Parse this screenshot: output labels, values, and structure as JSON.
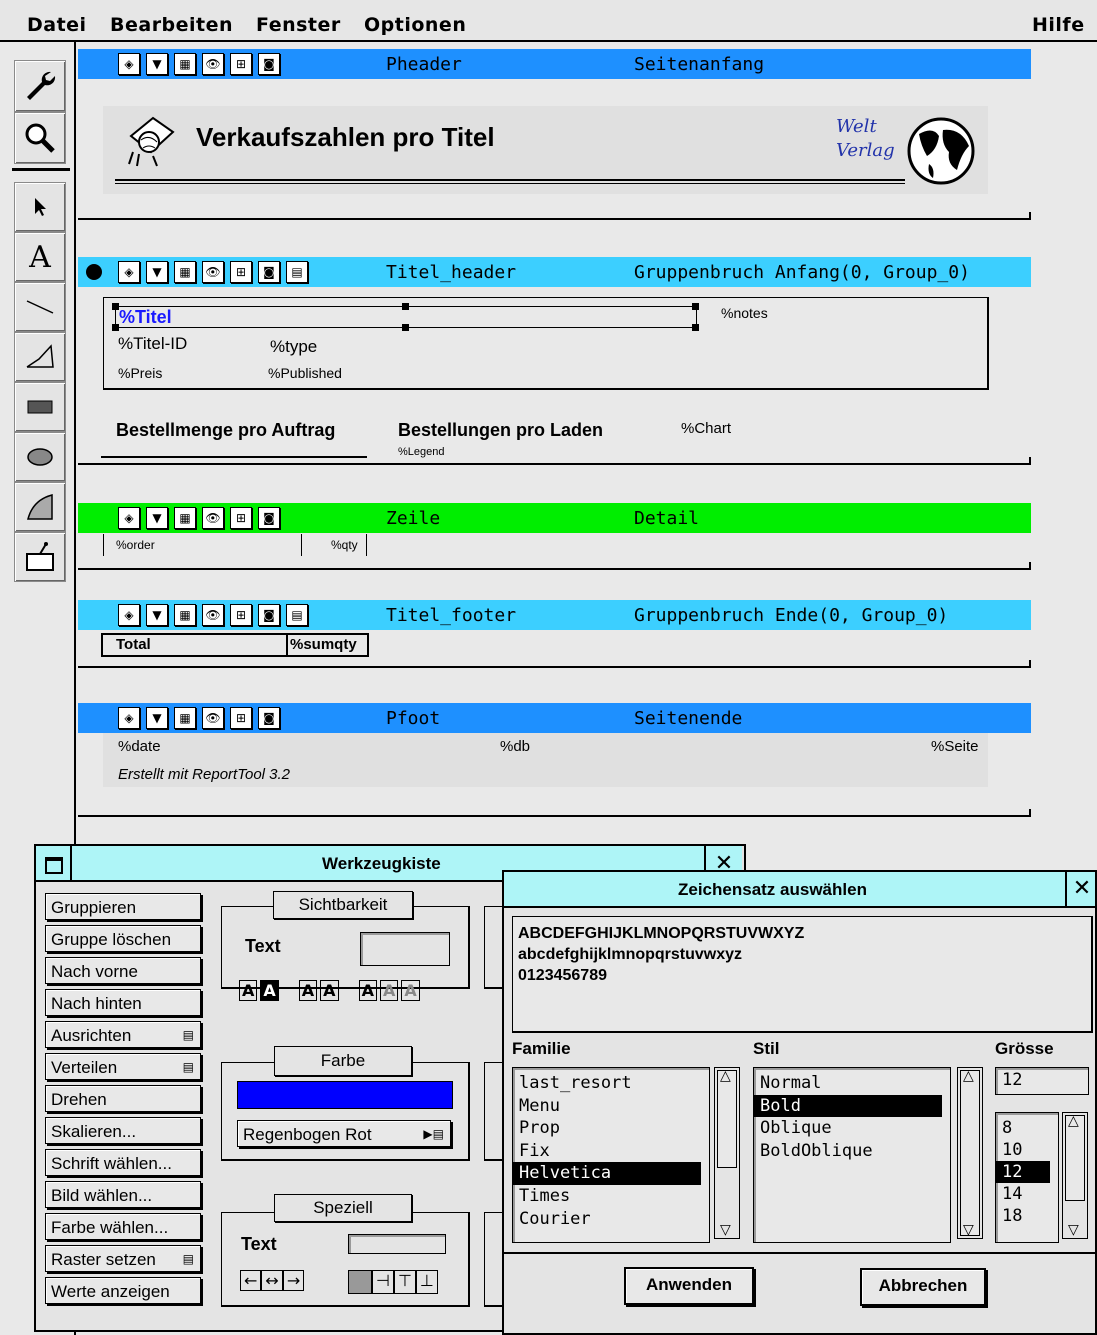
{
  "menubar": {
    "items": [
      "Datei",
      "Bearbeiten",
      "Fenster",
      "Optionen"
    ],
    "help": "Hilfe"
  },
  "bands": [
    {
      "name": "Pheader",
      "type": "Seitenanfang",
      "color": "#1e90ff"
    },
    {
      "name": "Titel_header",
      "type": "Gruppenbruch Anfang(0, Group_0)",
      "color": "#3ccfff"
    },
    {
      "name": "Zeile",
      "type": "Detail",
      "color": "#00ee00"
    },
    {
      "name": "Titel_footer",
      "type": "Gruppenbruch Ende(0, Group_0)",
      "color": "#3ccfff"
    },
    {
      "name": "Pfoot",
      "type": "Seitenende",
      "color": "#1e90ff"
    }
  ],
  "header": {
    "title": "Verkaufszahlen pro Titel",
    "logo_line1": "Welt",
    "logo_line2": "Verlag"
  },
  "titel_header": {
    "titel": "%Titel",
    "notes": "%notes",
    "titel_id": "%Titel-ID",
    "type": "%type",
    "preis": "%Preis",
    "published": "%Published",
    "bestellmenge": "Bestellmenge pro Auftrag",
    "bestellungen": "Bestellungen pro Laden",
    "chart": "%Chart",
    "legend": "%Legend"
  },
  "zeile": {
    "order": "%order",
    "qty": "%qty"
  },
  "titel_footer": {
    "total": "Total",
    "sumqty": "%sumqty"
  },
  "pfoot": {
    "date": "%date",
    "db": "%db",
    "seite": "%Seite",
    "credit": "Erstellt mit ReportTool 3.2"
  },
  "toolbox": {
    "title": "Werkzeugkiste",
    "buttons": [
      "Gruppieren",
      "Gruppe löschen",
      "Nach vorne",
      "Nach hinten",
      "Ausrichten",
      "Verteilen",
      "Drehen",
      "Skalieren...",
      "Schrift wählen...",
      "Bild wählen...",
      "Farbe wählen...",
      "Raster setzen",
      "Werte anzeigen"
    ],
    "sichtbarkeit": {
      "label": "Sichtbarkeit",
      "text": "Text"
    },
    "farbe": {
      "label": "Farbe",
      "swatch": "#0000ff",
      "option": "Regenbogen Rot"
    },
    "speziell": {
      "label": "Speziell",
      "text": "Text"
    }
  },
  "fontdialog": {
    "title": "Zeichensatz auswählen",
    "preview": [
      "ABCDEFGHIJKLMNOPQRSTUVWXYZ",
      "abcdefghijklmnopqrstuvwxyz",
      "0123456789"
    ],
    "familie_label": "Familie",
    "stil_label": "Stil",
    "groesse_label": "Grösse",
    "families": [
      "last_resort",
      "Menu",
      "Prop",
      "Fix",
      "Helvetica",
      "Times",
      "Courier"
    ],
    "selected_family": "Helvetica",
    "styles": [
      "Normal",
      "Bold",
      "Oblique",
      "BoldOblique"
    ],
    "selected_style": "Bold",
    "size_value": "12",
    "sizes": [
      "8",
      "10",
      "12",
      "14",
      "18"
    ],
    "selected_size": "12",
    "apply": "Anwenden",
    "cancel": "Abbrechen"
  }
}
